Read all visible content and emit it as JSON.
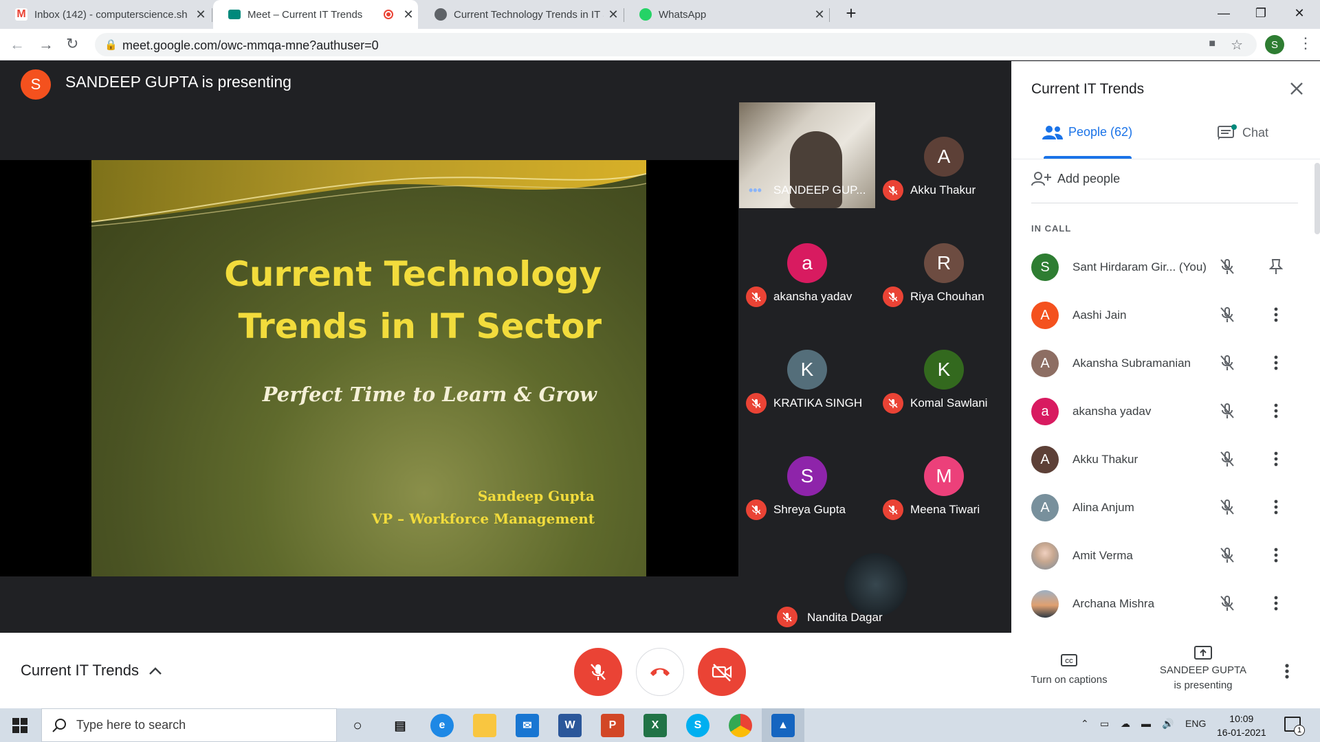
{
  "browser": {
    "tabs": [
      {
        "title": "Inbox (142) - computerscience.sh",
        "icon": "gmail-icon",
        "active": false
      },
      {
        "title": "Meet – Current IT Trends",
        "icon": "meet-icon",
        "active": true
      },
      {
        "title": "Current Technology Trends in IT S",
        "icon": "globe-icon",
        "active": false
      },
      {
        "title": "WhatsApp",
        "icon": "whatsapp-icon",
        "active": false
      }
    ],
    "url": "meet.google.com/owc-mmqa-mne?authuser=0",
    "profile_initial": "S"
  },
  "presenting": {
    "initial": "S",
    "text": "SANDEEP GUPTA is presenting",
    "avatar_color": "#f4511e"
  },
  "slide": {
    "title_line1": "Current Technology",
    "title_line2": "Trends in IT Sector",
    "subtitle": "Perfect Time to Learn & Grow",
    "author": "Sandeep Gupta",
    "role": "VP – Workforce Management"
  },
  "grid": [
    {
      "name": "SANDEEP GUP...",
      "initial": "",
      "color": "#3c4043",
      "video": true
    },
    {
      "name": "Akku Thakur",
      "initial": "A",
      "color": "#5d4037"
    },
    {
      "name": "akansha yadav",
      "initial": "a",
      "color": "#d81b60"
    },
    {
      "name": "Riya Chouhan",
      "initial": "R",
      "color": "#6d4c41"
    },
    {
      "name": "KRATIKA SINGH",
      "initial": "K",
      "color": "#546e7a"
    },
    {
      "name": "Komal Sawlani",
      "initial": "K",
      "color": "#33691e"
    },
    {
      "name": "Shreya Gupta",
      "initial": "S",
      "color": "#8e24aa"
    },
    {
      "name": "Meena Tiwari",
      "initial": "M",
      "color": "#ec407a"
    },
    {
      "name": "Nandita Dagar",
      "initial": "",
      "color": "#263238"
    }
  ],
  "panel": {
    "title": "Current IT Trends",
    "people_tab": "People (62)",
    "chat_tab": "Chat",
    "add_people": "Add people",
    "section": "IN CALL",
    "people": [
      {
        "name": "Sant Hirdaram Gir...  (You)",
        "initial": "S",
        "color": "#2e7d32",
        "action": "pin-icon"
      },
      {
        "name": "Aashi Jain",
        "initial": "A",
        "color": "#f4511e",
        "action": "more-vert-icon"
      },
      {
        "name": "Akansha Subramanian",
        "initial": "A",
        "color": "#8d6e63",
        "action": "more-vert-icon"
      },
      {
        "name": "akansha yadav",
        "initial": "a",
        "color": "#d81b60",
        "action": "more-vert-icon"
      },
      {
        "name": "Akku Thakur",
        "initial": "A",
        "color": "#5d4037",
        "action": "more-vert-icon"
      },
      {
        "name": "Alina Anjum",
        "initial": "A",
        "color": "#78909c",
        "action": "more-vert-icon"
      },
      {
        "name": "Amit Verma",
        "initial": "",
        "color": "#b0a090",
        "action": "more-vert-icon"
      },
      {
        "name": "Archana Mishra",
        "initial": "",
        "color": "#6b7d8c",
        "action": "more-vert-icon"
      }
    ]
  },
  "bottom": {
    "meeting_title": "Current IT Trends",
    "captions": "Turn on captions",
    "presenting_line1": "SANDEEP GUPTA",
    "presenting_line2": "is presenting"
  },
  "taskbar": {
    "search_placeholder": "Type here to search",
    "lang": "ENG",
    "time": "10:09",
    "date": "16-01-2021",
    "notifications": "1"
  }
}
